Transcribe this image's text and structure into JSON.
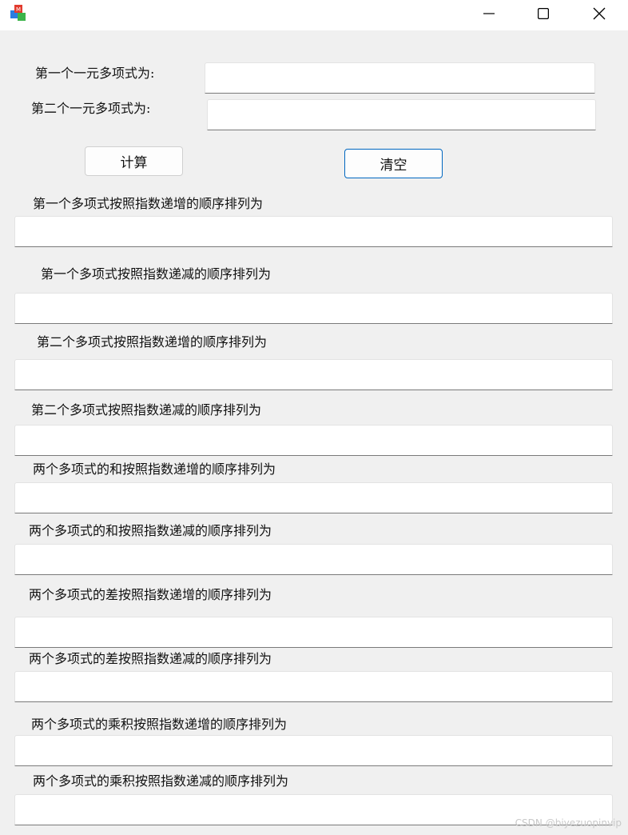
{
  "window": {
    "app_icon": "colorful-blocks-app-icon",
    "controls": [
      "minimize-icon",
      "maximize-icon",
      "close-icon"
    ]
  },
  "inputs": {
    "poly1_label": "第一个一元多项式为:",
    "poly1_value": "",
    "poly2_label": "第二个一元多项式为:",
    "poly2_value": ""
  },
  "buttons": {
    "calc": "计算",
    "clear": "清空"
  },
  "outputs": [
    {
      "label": "第一个多项式按照指数递增的顺序排列为",
      "value": ""
    },
    {
      "label": "第一个多项式按照指数递减的顺序排列为",
      "value": ""
    },
    {
      "label": "第二个多项式按照指数递增的顺序排列为",
      "value": ""
    },
    {
      "label": "第二个多项式按照指数递减的顺序排列为",
      "value": ""
    },
    {
      "label": "两个多项式的和按照指数递增的顺序排列为",
      "value": ""
    },
    {
      "label": "两个多项式的和按照指数递减的顺序排列为",
      "value": ""
    },
    {
      "label": "两个多项式的差按照指数递增的顺序排列为",
      "value": ""
    },
    {
      "label": "两个多项式的差按照指数递减的顺序排列为",
      "value": ""
    },
    {
      "label": "两个多项式的乘积按照指数递增的顺序排列为",
      "value": ""
    },
    {
      "label": "两个多项式的乘积按照指数递减的顺序排列为",
      "value": ""
    }
  ],
  "watermark": "CSDN @biyezuopinvip"
}
